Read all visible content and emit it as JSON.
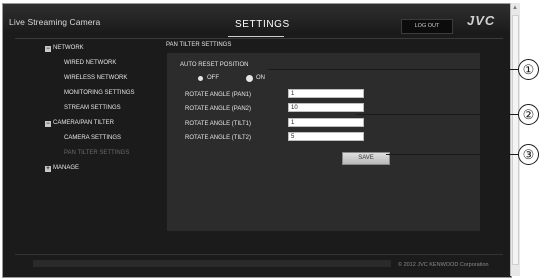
{
  "header": {
    "app_title": "Live Streaming Camera",
    "page_title": "SETTINGS",
    "logout_label": "LOG OUT",
    "logo": "JVC"
  },
  "sidebar": {
    "network": "NETWORK",
    "wired": "WIRED NETWORK",
    "wireless": "WIRELESS NETWORK",
    "monitoring": "MONITORING SETTINGS",
    "stream": "STREAM SETTINGS",
    "camera_pt": "CAMERA/PAN TILTER",
    "camera_settings": "CAMERA SETTINGS",
    "pan_tilter_settings": "PAN TILTER SETTINGS",
    "manage": "MANAGE"
  },
  "panel": {
    "title": "PAN TILTER SETTINGS",
    "auto_reset_label": "AUTO RESET POSITION",
    "off_label": "OFF",
    "on_label": "ON",
    "selected": "ON",
    "pan1_label": "ROTATE ANGLE (PAN1)",
    "pan1_value": "1",
    "pan2_label": "ROTATE ANGLE (PAN2)",
    "pan2_value": "10",
    "tilt1_label": "ROTATE ANGLE (TILT1)",
    "tilt1_value": "1",
    "tilt2_label": "ROTATE ANGLE (TILT2)",
    "tilt2_value": "5",
    "save_label": "SAVE"
  },
  "footer": {
    "copyright": "© 2012 JVC KENWOOD Corporation"
  },
  "callouts": [
    "①",
    "②",
    "③"
  ]
}
